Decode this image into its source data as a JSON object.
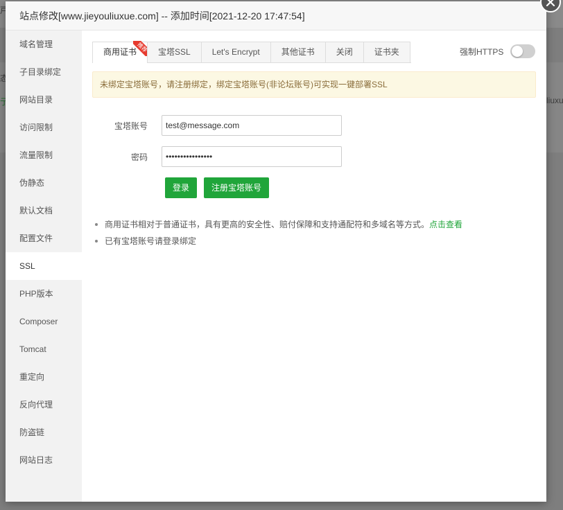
{
  "background": {
    "frag_title": "戸",
    "frag_left_1": "态",
    "frag_left_2": "亍",
    "frag_right": "liuxu"
  },
  "dialog": {
    "title": "站点修改[www.jieyouliuxue.com] -- 添加时间[2021-12-20 17:47:54]",
    "close_icon": "close-icon"
  },
  "sidebar": {
    "items": [
      {
        "label": "域名管理"
      },
      {
        "label": "子目录绑定"
      },
      {
        "label": "网站目录"
      },
      {
        "label": "访问限制"
      },
      {
        "label": "流量限制"
      },
      {
        "label": "伪静态"
      },
      {
        "label": "默认文档"
      },
      {
        "label": "配置文件"
      },
      {
        "label": "SSL"
      },
      {
        "label": "PHP版本"
      },
      {
        "label": "Composer"
      },
      {
        "label": "Tomcat"
      },
      {
        "label": "重定向"
      },
      {
        "label": "反向代理"
      },
      {
        "label": "防盗链"
      },
      {
        "label": "网站日志"
      }
    ],
    "active_index": 8
  },
  "tabs": {
    "items": [
      {
        "label": "商用证书",
        "badge": "推荐"
      },
      {
        "label": "宝塔SSL"
      },
      {
        "label": "Let's Encrypt"
      },
      {
        "label": "其他证书"
      },
      {
        "label": "关闭"
      },
      {
        "label": "证书夹"
      }
    ],
    "active_index": 0
  },
  "https": {
    "label": "强制HTTPS",
    "enabled": false
  },
  "notice": {
    "text": "未绑定宝塔账号，请注册绑定，绑定宝塔账号(非论坛账号)可实现一键部署SSL"
  },
  "form": {
    "account_label": "宝塔账号",
    "account_value": "test@message.com",
    "password_label": "密码",
    "password_value": "••••••••••••••••",
    "login_button": "登录",
    "register_button": "注册宝塔账号"
  },
  "tips": {
    "tip1_text": "商用证书相对于普通证书，具有更高的安全性、赔付保障和支持通配符和多域名等方式。",
    "tip1_link": "点击查看",
    "tip2_text": "已有宝塔账号请登录绑定"
  },
  "colors": {
    "accent": "#20a53a",
    "notice_bg": "#fcf8e3",
    "notice_text": "#8a6d3b",
    "ribbon": "#e63a2e"
  }
}
